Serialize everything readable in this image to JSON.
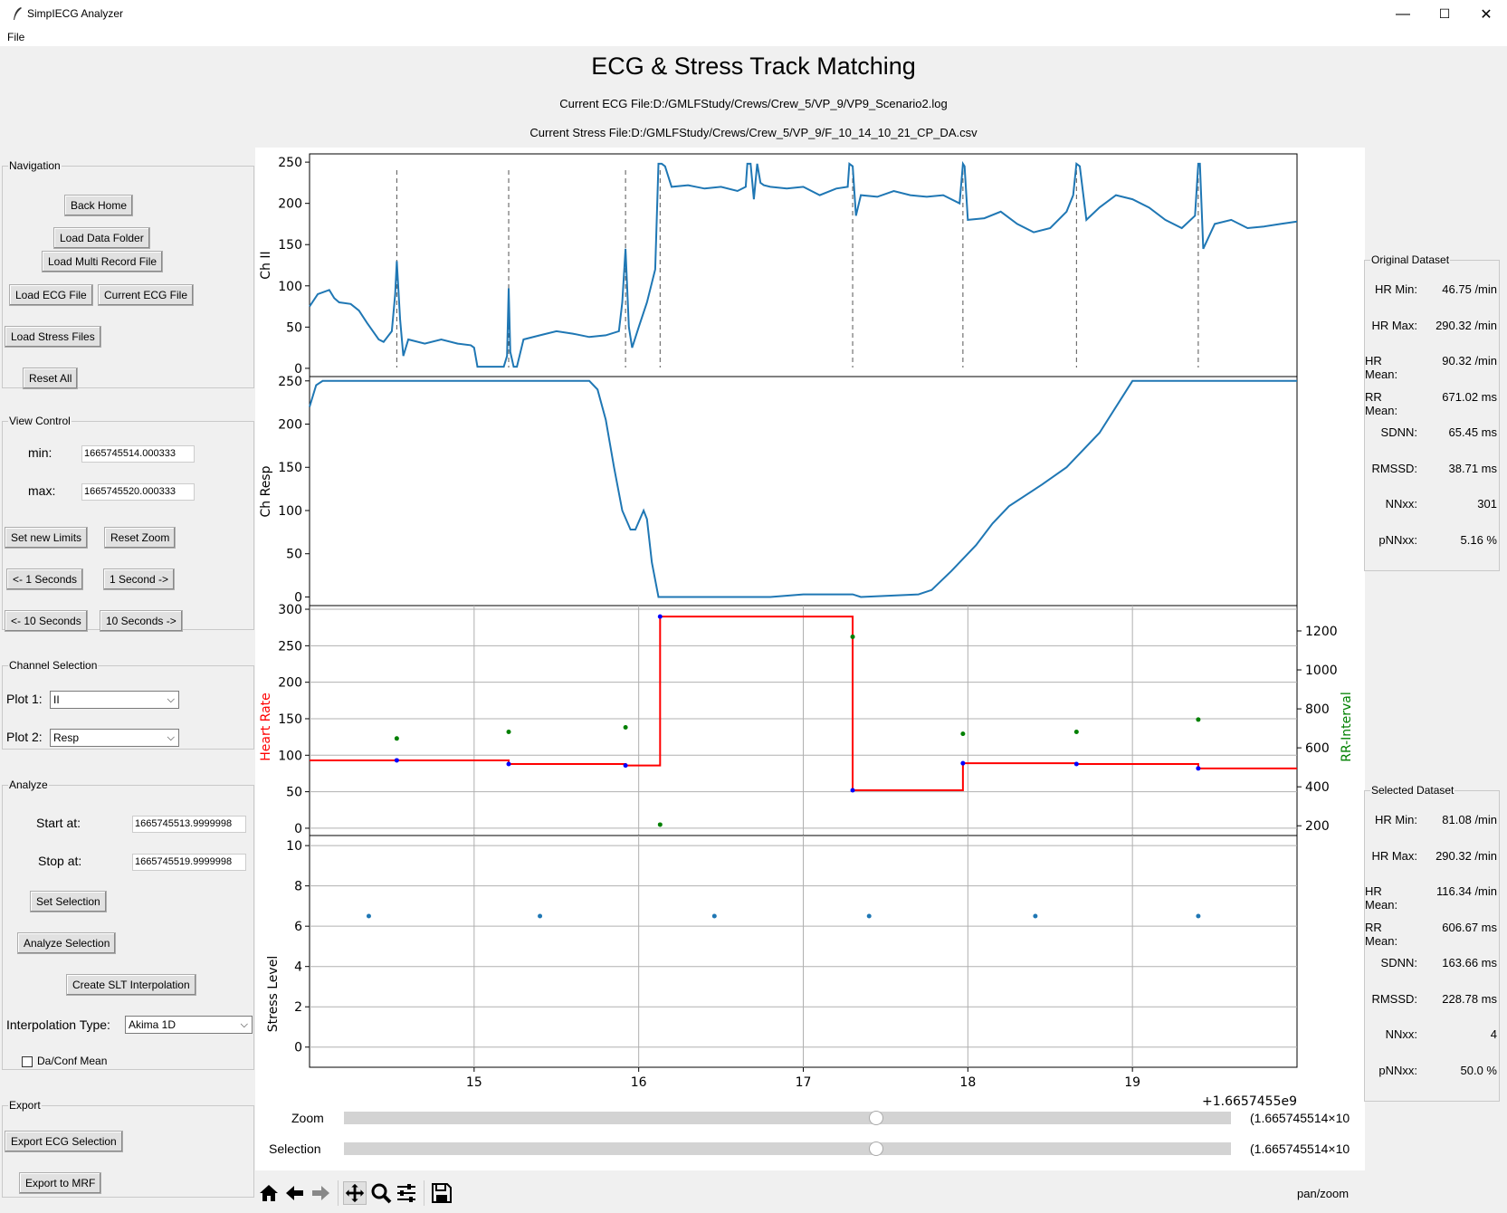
{
  "window": {
    "title": "SimpIECG Analyzer",
    "minimize": "—",
    "maximize": "☐",
    "close": "✕"
  },
  "menu": {
    "file": "File"
  },
  "header": {
    "title": "ECG & Stress Track Matching",
    "ecg_file": "Current ECG File:D:/GMLFStudy/Crews/Crew_5/VP_9/VP9_Scenario2.log",
    "stress_file": "Current Stress File:D:/GMLFStudy/Crews/Crew_5/VP_9/F_10_14_10_21_CP_DA.csv"
  },
  "navigation": {
    "legend": "Navigation",
    "back_home": "Back Home",
    "load_data_folder": "Load Data Folder",
    "load_multi_record": "Load Multi Record File",
    "load_ecg": "Load ECG File",
    "current_ecg": "Current ECG File",
    "load_stress": "Load Stress Files",
    "reset_all": "Reset All"
  },
  "view_control": {
    "legend": "View Control",
    "min_label": "min:",
    "min_value": "1665745514.000333",
    "max_label": "max:",
    "max_value": "1665745520.000333",
    "set_limits": "Set new Limits",
    "reset_zoom": "Reset Zoom",
    "back_1": "<- 1 Seconds",
    "fwd_1": "1 Second ->",
    "back_10": "<- 10 Seconds",
    "fwd_10": "10 Seconds ->"
  },
  "channel_selection": {
    "legend": "Channel Selection",
    "plot1_label": "Plot 1:",
    "plot1_value": "II",
    "plot2_label": "Plot 2:",
    "plot2_value": "Resp"
  },
  "analyze": {
    "legend": "Analyze",
    "start_label": "Start at:",
    "start_value": "1665745513.9999998",
    "stop_label": "Stop at:",
    "stop_value": "1665745519.9999998",
    "set_selection": "Set Selection",
    "analyze_selection": "Analyze Selection",
    "create_slt": "Create SLT Interpolation",
    "interp_label": "Interpolation Type:",
    "interp_value": "Akima 1D",
    "da_conf_label": "Da/Conf Mean"
  },
  "export": {
    "legend": "Export",
    "export_ecg": "Export ECG Selection",
    "export_mrf": "Export to MRF"
  },
  "original_dataset": {
    "legend": "Original Dataset",
    "rows": [
      {
        "k": "HR Min:",
        "v": "46.75 /min"
      },
      {
        "k": "HR Max:",
        "v": "290.32 /min"
      },
      {
        "k": "HR Mean:",
        "v": "90.32 /min"
      },
      {
        "k": "RR Mean:",
        "v": "671.02 ms"
      },
      {
        "k": "SDNN:",
        "v": "65.45 ms"
      },
      {
        "k": "RMSSD:",
        "v": "38.71 ms"
      },
      {
        "k": "NNxx:",
        "v": "301"
      },
      {
        "k": "pNNxx:",
        "v": "5.16 %"
      }
    ]
  },
  "selected_dataset": {
    "legend": "Selected Dataset",
    "rows": [
      {
        "k": "HR Min:",
        "v": "81.08 /min"
      },
      {
        "k": "HR Max:",
        "v": "290.32 /min"
      },
      {
        "k": "HR Mean:",
        "v": "116.34 /min"
      },
      {
        "k": "RR Mean:",
        "v": "606.67 ms"
      },
      {
        "k": "SDNN:",
        "v": "163.66 ms"
      },
      {
        "k": "RMSSD:",
        "v": "228.78 ms"
      },
      {
        "k": "NNxx:",
        "v": "4"
      },
      {
        "k": "pNNxx:",
        "v": "50.0 %"
      }
    ]
  },
  "sliders": {
    "zoom_label": "Zoom",
    "zoom_value": "(1.665745514×10",
    "zoom_fraction": 0.6,
    "selection_label": "Selection",
    "selection_value": "(1.665745514×10",
    "selection_fraction": 0.6
  },
  "toolbar": {
    "icons": [
      "home-icon",
      "back-arrow-icon",
      "forward-arrow-icon",
      "pan-icon",
      "zoom-icon",
      "configure-icon",
      "save-icon"
    ],
    "mode": "pan/zoom"
  },
  "colors": {
    "ecg_line": "#1f77b4",
    "hr_line": "#ff0000",
    "rr_points": "#008000",
    "hr_points": "#0000ff"
  },
  "chart_data": [
    {
      "type": "line",
      "ylabel": "Ch II",
      "ylim": [
        -10,
        260
      ],
      "yticks": [
        0,
        50,
        100,
        150,
        200,
        250
      ],
      "xlim": [
        14.0,
        20.0
      ],
      "rpeaks": [
        14.53,
        15.21,
        15.92,
        16.13,
        17.3,
        17.97,
        18.66,
        19.4
      ],
      "x": [
        14.0,
        14.05,
        14.12,
        14.15,
        14.18,
        14.25,
        14.3,
        14.35,
        14.42,
        14.45,
        14.5,
        14.52,
        14.53,
        14.55,
        14.57,
        14.6,
        14.7,
        14.8,
        14.9,
        14.98,
        15.0,
        15.02,
        15.1,
        15.18,
        15.2,
        15.21,
        15.22,
        15.24,
        15.26,
        15.3,
        15.4,
        15.5,
        15.6,
        15.7,
        15.8,
        15.88,
        15.9,
        15.92,
        15.94,
        15.96,
        16.0,
        16.05,
        16.1,
        16.12,
        16.14,
        16.16,
        16.2,
        16.3,
        16.4,
        16.5,
        16.6,
        16.65,
        16.66,
        16.68,
        16.7,
        16.72,
        16.74,
        16.76,
        16.8,
        16.9,
        17.0,
        17.1,
        17.2,
        17.27,
        17.28,
        17.3,
        17.32,
        17.35,
        17.45,
        17.55,
        17.65,
        17.75,
        17.85,
        17.95,
        17.97,
        17.98,
        18.0,
        18.1,
        18.2,
        18.3,
        18.4,
        18.5,
        18.6,
        18.64,
        18.66,
        18.68,
        18.72,
        18.8,
        18.9,
        19.0,
        19.1,
        19.2,
        19.3,
        19.38,
        19.4,
        19.41,
        19.43,
        19.5,
        19.6,
        19.7,
        19.8,
        19.9,
        20.0
      ],
      "y": [
        75,
        90,
        95,
        85,
        80,
        78,
        70,
        55,
        35,
        32,
        45,
        90,
        130,
        60,
        15,
        35,
        30,
        35,
        30,
        28,
        25,
        2,
        2,
        2,
        15,
        97,
        20,
        2,
        2,
        35,
        40,
        45,
        42,
        38,
        40,
        45,
        80,
        145,
        50,
        25,
        50,
        80,
        120,
        248,
        248,
        245,
        220,
        222,
        218,
        220,
        215,
        220,
        248,
        248,
        205,
        248,
        225,
        222,
        220,
        218,
        220,
        210,
        218,
        220,
        248,
        245,
        185,
        210,
        208,
        215,
        210,
        208,
        210,
        200,
        248,
        245,
        180,
        182,
        190,
        175,
        165,
        170,
        190,
        210,
        248,
        245,
        180,
        195,
        210,
        205,
        195,
        180,
        170,
        185,
        248,
        248,
        145,
        175,
        180,
        170,
        172,
        175,
        178
      ]
    },
    {
      "type": "line",
      "ylabel": "Ch Resp",
      "ylim": [
        -10,
        255
      ],
      "yticks": [
        0,
        50,
        100,
        150,
        200,
        250
      ],
      "xlim": [
        14.0,
        20.0
      ],
      "x": [
        14.0,
        14.04,
        14.08,
        14.3,
        15.7,
        15.75,
        15.8,
        15.85,
        15.9,
        15.95,
        15.98,
        16.03,
        16.05,
        16.08,
        16.12,
        16.8,
        17.0,
        17.3,
        17.35,
        17.7,
        17.78,
        17.9,
        18.05,
        18.15,
        18.25,
        18.45,
        18.6,
        18.8,
        19.0,
        20.0
      ],
      "y": [
        220,
        245,
        250,
        250,
        250,
        240,
        205,
        150,
        100,
        78,
        78,
        100,
        90,
        40,
        0,
        0,
        3,
        3,
        0,
        3,
        8,
        30,
        60,
        85,
        105,
        130,
        150,
        190,
        250,
        250
      ]
    },
    {
      "type": "line",
      "ylabel": "Heart Rate",
      "y2label": "RR-Interval",
      "ylim": [
        -10,
        305
      ],
      "yticks": [
        0,
        50,
        100,
        150,
        200,
        250,
        300
      ],
      "y2lim": [
        150,
        1330
      ],
      "y2ticks": [
        200,
        400,
        600,
        800,
        1000,
        1200
      ],
      "xlim": [
        14.0,
        20.0
      ],
      "hr_x": [
        14.53,
        15.21,
        15.92,
        16.13,
        17.3,
        17.97,
        18.66,
        19.4
      ],
      "hr_y": [
        93,
        88,
        86,
        290,
        52,
        89,
        88,
        82
      ],
      "rr_x": [
        14.53,
        15.21,
        15.92,
        16.13,
        17.3,
        17.97,
        18.66,
        19.4
      ],
      "rr_y": [
        648,
        682,
        705,
        206,
        1170,
        672,
        682,
        745
      ]
    },
    {
      "type": "scatter",
      "ylabel": "Stress Level",
      "ylim": [
        -1,
        10.5
      ],
      "yticks": [
        0,
        2,
        4,
        6,
        8,
        10
      ],
      "xlim": [
        14.0,
        20.0
      ],
      "xticks": [
        15,
        16,
        17,
        18,
        19
      ],
      "x_offset": "+1.6657455e9",
      "x": [
        14.36,
        15.4,
        16.46,
        17.4,
        18.41,
        19.4
      ],
      "y": [
        6.5,
        6.5,
        6.5,
        6.5,
        6.5,
        6.5
      ]
    }
  ]
}
